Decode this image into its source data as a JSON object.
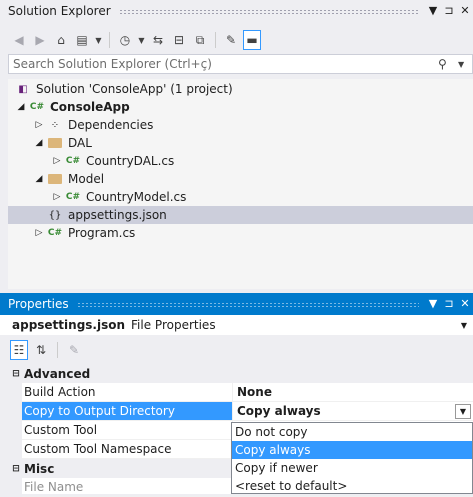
{
  "solution_explorer": {
    "title": "Solution Explorer",
    "controls": [
      "▼",
      "⊐",
      "✕"
    ],
    "search_placeholder": "Search Solution Explorer (Ctrl+ç)",
    "tree": [
      {
        "label": "Solution 'ConsoleApp' (1 project)",
        "icon": "solution-icon",
        "expand": ""
      },
      {
        "label": "ConsoleApp",
        "icon": "csharp-project-icon",
        "expand": "◢",
        "bold": true
      },
      {
        "label": "Dependencies",
        "icon": "dependencies-icon",
        "expand": "▷"
      },
      {
        "label": "DAL",
        "icon": "folder-icon",
        "expand": "◢"
      },
      {
        "label": "CountryDAL.cs",
        "icon": "csharp-file-icon",
        "expand": "▷"
      },
      {
        "label": "Model",
        "icon": "folder-icon",
        "expand": "◢"
      },
      {
        "label": "CountryModel.cs",
        "icon": "csharp-file-icon",
        "expand": "▷"
      },
      {
        "label": "appsettings.json",
        "icon": "json-file-icon",
        "expand": "",
        "selected": true
      },
      {
        "label": "Program.cs",
        "icon": "csharp-file-icon",
        "expand": "▷"
      }
    ]
  },
  "properties": {
    "title": "Properties",
    "controls": [
      "▼",
      "⊐",
      "✕"
    ],
    "object_name": "appsettings.json",
    "object_type": "File Properties",
    "categories": {
      "advanced": "Advanced",
      "misc": "Misc"
    },
    "rows": {
      "build_action": {
        "name": "Build Action",
        "value": "None"
      },
      "copy_to_output": {
        "name": "Copy to Output Directory",
        "value": "Copy always"
      },
      "custom_tool": {
        "name": "Custom Tool",
        "value": ""
      },
      "custom_tool_ns": {
        "name": "Custom Tool Namespace",
        "value": ""
      },
      "file_name": {
        "name": "File Name",
        "value": ""
      }
    },
    "dropdown_options": [
      "Do not copy",
      "Copy always",
      "Copy if newer",
      "<reset to default>"
    ],
    "dropdown_selected_index": 1
  },
  "colors": {
    "accent": "#007acc",
    "selection": "#3399ff",
    "tree_selection": "#cccedb"
  }
}
